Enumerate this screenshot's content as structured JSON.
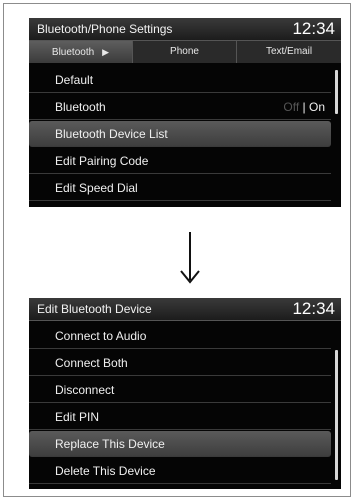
{
  "screen1": {
    "title": "Bluetooth/Phone Settings",
    "clock": "12:34",
    "tabs": [
      {
        "label": "Bluetooth",
        "arrow": "▶"
      },
      {
        "label": "Phone"
      },
      {
        "label": "Text/Email"
      }
    ],
    "items": [
      {
        "label": "Default"
      },
      {
        "label": "Bluetooth",
        "toggle_off": "Off",
        "toggle_sep": " | ",
        "toggle_on": "On"
      },
      {
        "label": "Bluetooth Device List"
      },
      {
        "label": "Edit Pairing Code"
      },
      {
        "label": "Edit Speed Dial"
      }
    ],
    "selected": "Bluetooth Device List"
  },
  "arrow_icon": "arrow-down-icon",
  "screen2": {
    "title": "Edit Bluetooth Device",
    "clock": "12:34",
    "items": [
      {
        "label": "Connect to Audio"
      },
      {
        "label": "Connect Both"
      },
      {
        "label": "Disconnect"
      },
      {
        "label": "Edit PIN"
      },
      {
        "label": "Replace This Device"
      },
      {
        "label": "Delete This Device"
      }
    ],
    "selected": "Replace This Device"
  }
}
